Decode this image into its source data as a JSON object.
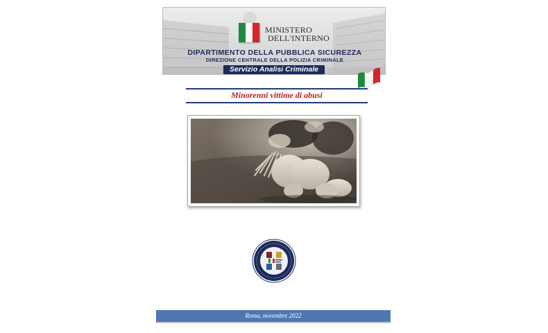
{
  "header": {
    "ministry_line1": "MINISTERO",
    "ministry_line2": "DELL'INTERNO",
    "department": "DIPARTIMENTO DELLA PUBBLICA SICUREZZA",
    "direction": "DIREZIONE CENTRALE DELLA POLIZIA CRIMINALE",
    "service": "Servizio Analisi Criminale"
  },
  "document": {
    "title": "Minorenni vittime di abusi"
  },
  "footer": {
    "place_date": "Roma, novembre 2022"
  },
  "colors": {
    "navy": "#1d2a5c",
    "title_red": "#b41c24",
    "footer_blue": "#5077b2",
    "flag_green": "#1f8a3d",
    "flag_red": "#d3262b"
  },
  "icons": {
    "flag": "italian-flag-icon",
    "emblem": "police-emblem-icon"
  }
}
